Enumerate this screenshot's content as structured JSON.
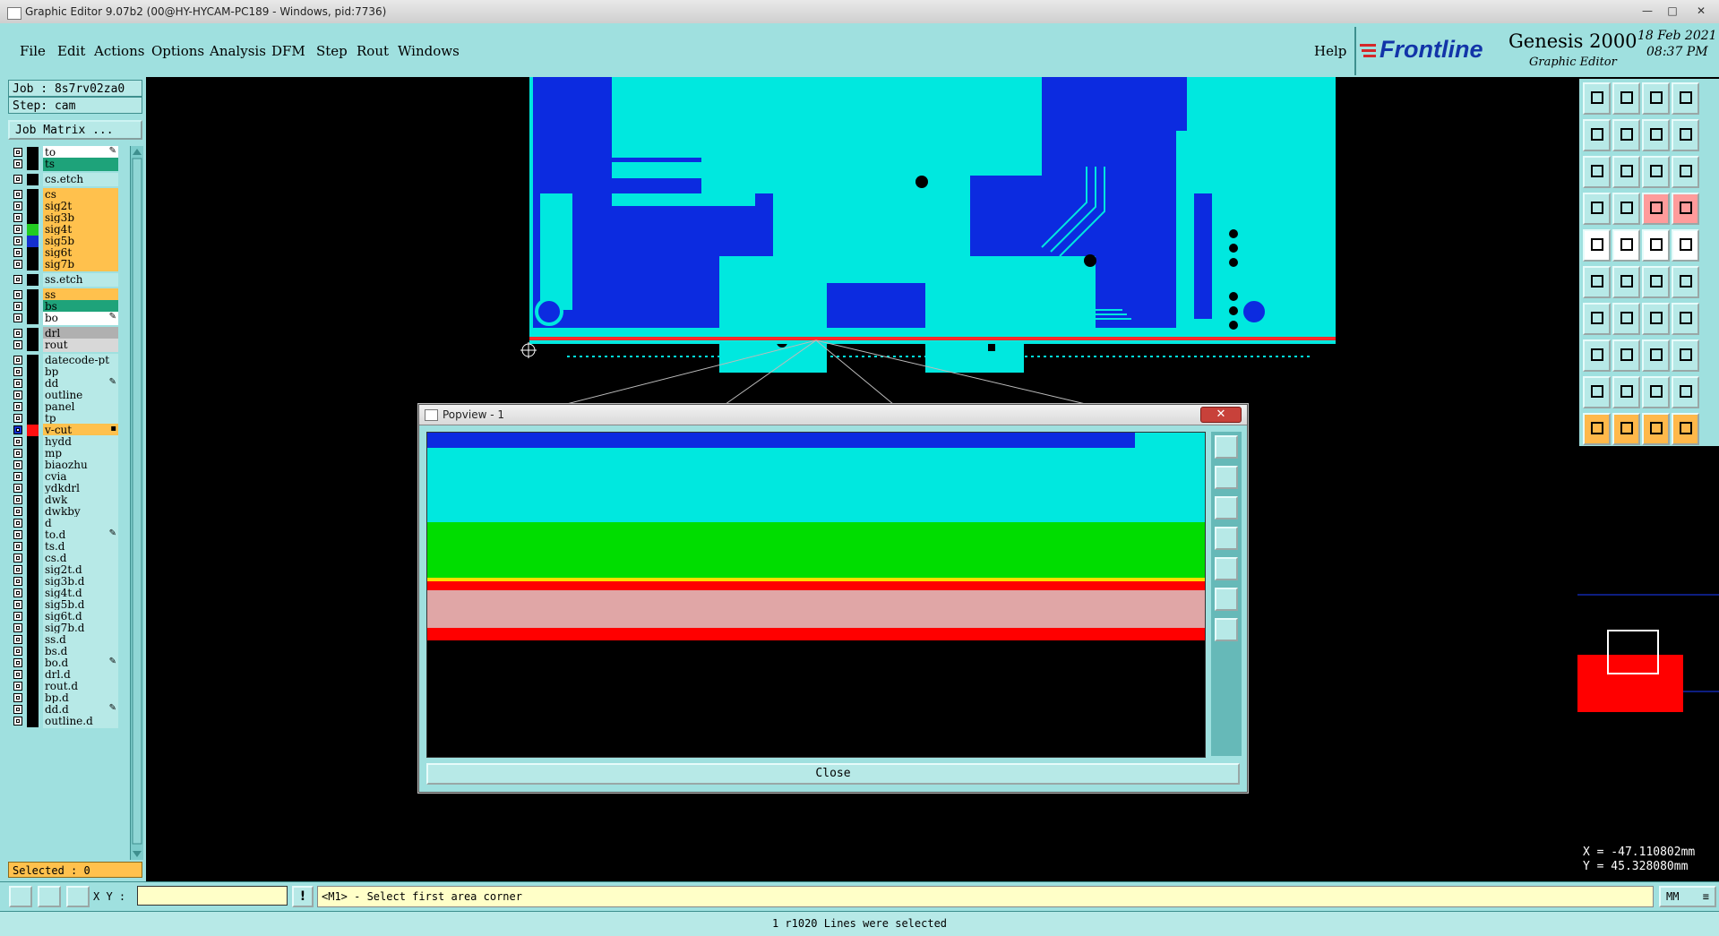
{
  "window": {
    "title": "Graphic Editor 9.07b2 (00@HY-HYCAM-PC189 - Windows, pid:7736)",
    "controls": [
      "—",
      "□",
      "✕"
    ]
  },
  "menu": {
    "items": [
      "File",
      "Edit",
      "Actions",
      "Options",
      "Analysis",
      "DFM",
      "Step",
      "Rout",
      "Windows"
    ],
    "help": "Help"
  },
  "brand": {
    "logo": "Frontline",
    "product": "Genesis 2000",
    "subtitle": "Graphic Editor",
    "date": "18 Feb 2021",
    "time": "08:37 PM"
  },
  "job": {
    "job_line": "Job : 8s7rv02za0",
    "step_line": "Step: cam",
    "matrix_button": "Job Matrix ..."
  },
  "layers": [
    {
      "name": "to",
      "bg": "#ffffff",
      "sw": "#000000",
      "mark": "✎"
    },
    {
      "name": "ts",
      "bg": "#1ea37a",
      "sw": "#000000",
      "mark": ""
    },
    {
      "name": "cs.etch",
      "bg": "#b7e9e7",
      "sw": "#000000",
      "mark": ""
    },
    {
      "name": "cs",
      "bg": "#ffc14d",
      "sw": "#000000",
      "mark": ""
    },
    {
      "name": "sig2t",
      "bg": "#ffc14d",
      "sw": "#000000",
      "mark": ""
    },
    {
      "name": "sig3b",
      "bg": "#ffc14d",
      "sw": "#000000",
      "mark": ""
    },
    {
      "name": "sig4t",
      "bg": "#ffc14d",
      "sw": "#22cc22",
      "mark": ""
    },
    {
      "name": "sig5b",
      "bg": "#ffc14d",
      "sw": "#1430d0",
      "mark": ""
    },
    {
      "name": "sig6t",
      "bg": "#ffc14d",
      "sw": "#000000",
      "mark": ""
    },
    {
      "name": "sig7b",
      "bg": "#ffc14d",
      "sw": "#000000",
      "mark": ""
    },
    {
      "name": "ss.etch",
      "bg": "#b7e9e7",
      "sw": "#000000",
      "mark": ""
    },
    {
      "name": "ss",
      "bg": "#ffc14d",
      "sw": "#000000",
      "mark": ""
    },
    {
      "name": "bs",
      "bg": "#1ea37a",
      "sw": "#000000",
      "mark": ""
    },
    {
      "name": "bo",
      "bg": "#ffffff",
      "sw": "#000000",
      "mark": "✎"
    },
    {
      "name": "drl",
      "bg": "#b0b0b0",
      "sw": "#000000",
      "mark": ""
    },
    {
      "name": "rout",
      "bg": "#d8d8d8",
      "sw": "#000000",
      "mark": ""
    },
    {
      "name": "datecode-pt",
      "bg": "#b7e9e7",
      "sw": "#000000",
      "mark": ""
    },
    {
      "name": "bp",
      "bg": "#b7e9e7",
      "sw": "#000000",
      "mark": ""
    },
    {
      "name": "dd",
      "bg": "#b7e9e7",
      "sw": "#000000",
      "mark": "✎"
    },
    {
      "name": "outline",
      "bg": "#b7e9e7",
      "sw": "#000000",
      "mark": ""
    },
    {
      "name": "panel",
      "bg": "#b7e9e7",
      "sw": "#000000",
      "mark": ""
    },
    {
      "name": "tp",
      "bg": "#b7e9e7",
      "sw": "#000000",
      "mark": ""
    },
    {
      "name": "v-cut",
      "bg": "#ffc14d",
      "sw": "#ff1010",
      "mark": "▪",
      "cb": "#1430d0"
    },
    {
      "name": "hydd",
      "bg": "#b7e9e7",
      "sw": "#000000",
      "mark": ""
    },
    {
      "name": "mp",
      "bg": "#b7e9e7",
      "sw": "#000000",
      "mark": ""
    },
    {
      "name": "biaozhu",
      "bg": "#b7e9e7",
      "sw": "#000000",
      "mark": ""
    },
    {
      "name": "cvia",
      "bg": "#b7e9e7",
      "sw": "#000000",
      "mark": ""
    },
    {
      "name": "ydkdrl",
      "bg": "#b7e9e7",
      "sw": "#000000",
      "mark": ""
    },
    {
      "name": "dwk",
      "bg": "#b7e9e7",
      "sw": "#000000",
      "mark": ""
    },
    {
      "name": "dwkby",
      "bg": "#b7e9e7",
      "sw": "#000000",
      "mark": ""
    },
    {
      "name": "d",
      "bg": "#b7e9e7",
      "sw": "#000000",
      "mark": ""
    },
    {
      "name": "to.d",
      "bg": "#b7e9e7",
      "sw": "#000000",
      "mark": "✎"
    },
    {
      "name": "ts.d",
      "bg": "#b7e9e7",
      "sw": "#000000",
      "mark": ""
    },
    {
      "name": "cs.d",
      "bg": "#b7e9e7",
      "sw": "#000000",
      "mark": ""
    },
    {
      "name": "sig2t.d",
      "bg": "#b7e9e7",
      "sw": "#000000",
      "mark": ""
    },
    {
      "name": "sig3b.d",
      "bg": "#b7e9e7",
      "sw": "#000000",
      "mark": ""
    },
    {
      "name": "sig4t.d",
      "bg": "#b7e9e7",
      "sw": "#000000",
      "mark": ""
    },
    {
      "name": "sig5b.d",
      "bg": "#b7e9e7",
      "sw": "#000000",
      "mark": ""
    },
    {
      "name": "sig6t.d",
      "bg": "#b7e9e7",
      "sw": "#000000",
      "mark": ""
    },
    {
      "name": "sig7b.d",
      "bg": "#b7e9e7",
      "sw": "#000000",
      "mark": ""
    },
    {
      "name": "ss.d",
      "bg": "#b7e9e7",
      "sw": "#000000",
      "mark": ""
    },
    {
      "name": "bs.d",
      "bg": "#b7e9e7",
      "sw": "#000000",
      "mark": ""
    },
    {
      "name": "bo.d",
      "bg": "#b7e9e7",
      "sw": "#000000",
      "mark": "✎"
    },
    {
      "name": "drl.d",
      "bg": "#b7e9e7",
      "sw": "#000000",
      "mark": ""
    },
    {
      "name": "rout.d",
      "bg": "#b7e9e7",
      "sw": "#000000",
      "mark": ""
    },
    {
      "name": "bp.d",
      "bg": "#b7e9e7",
      "sw": "#000000",
      "mark": ""
    },
    {
      "name": "dd.d",
      "bg": "#b7e9e7",
      "sw": "#000000",
      "mark": "✎"
    },
    {
      "name": "outline.d",
      "bg": "#b7e9e7",
      "sw": "#000000",
      "mark": ""
    }
  ],
  "selected": "Selected : 0",
  "popview": {
    "title": "Popview - 1",
    "close_x": "✕",
    "close_button": "Close",
    "tool_icons": [
      "zoom-box-icon",
      "pan-up-icon",
      "pan-down-icon",
      "pan-left-icon",
      "pan-right-icon",
      "zoom-fit-icon",
      "zoom-home-icon"
    ]
  },
  "tools": {
    "icon_names": [
      "zoom-in-icon",
      "zoom-out-icon",
      "home-view-icon",
      "redraw-icon",
      "pan-left-icon",
      "pan-right-icon",
      "zoom-back-icon",
      "refresh-icon",
      "fit-icon",
      "center-icon",
      "scale-1to1-icon",
      "query-icon",
      "measure-icon",
      "snap-icon",
      "grid-icon",
      "layer-icon",
      "pad-icon",
      "cutout-icon",
      "line-style-icon",
      "circle-icon",
      "select-node-icon",
      "cross-icon",
      "link-icon",
      "break-icon",
      "angle-icon",
      "slash-icon",
      "arc-icon",
      "fill-icon",
      "group-icon",
      "dash-icon",
      "frame-icon",
      "copy-icon",
      "triangle-icon",
      "triangle-outline-icon",
      "arch-icon",
      "peak-icon",
      "pointer-icon",
      "pointer-select-icon",
      "pointer-move-icon",
      "pointer-edit-icon"
    ]
  },
  "coords": {
    "x": "X = -47.110802mm",
    "y": "Y = 45.328080mm"
  },
  "bottom": {
    "xy_label": "X Y :",
    "xy_value": "",
    "warn": "!",
    "prompt": "<M1> - Select first area corner",
    "units": "MM"
  },
  "status": "1 r1020 Lines were selected"
}
